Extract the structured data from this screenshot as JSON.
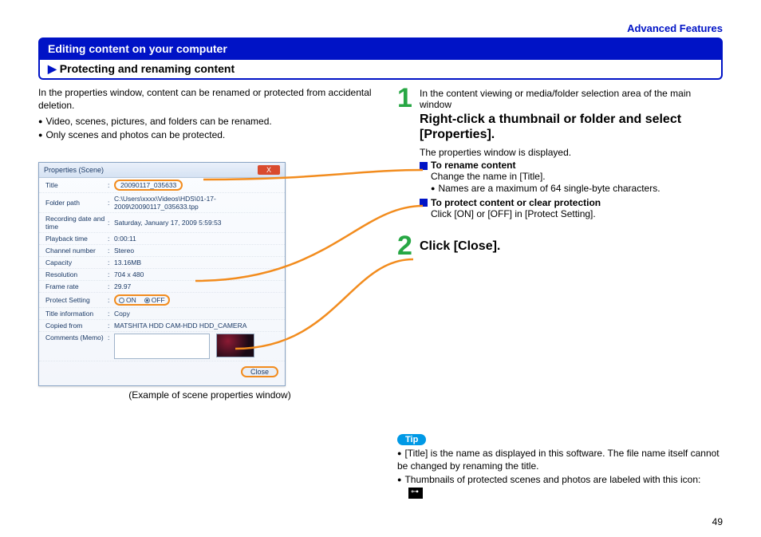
{
  "header": {
    "category": "Advanced Features"
  },
  "section": {
    "title": "Editing content on your computer",
    "subtitle": "Protecting and renaming content"
  },
  "left": {
    "intro": "In the properties window, content can be renamed or protected from accidental deletion.",
    "b1": "Video, scenes, pictures, and folders can be renamed.",
    "b2": "Only scenes and photos can be protected.",
    "caption": "(Example of scene properties window)"
  },
  "propwin": {
    "wtitle": "Properties (Scene)",
    "close_x": "X",
    "rows": {
      "title_l": "Title",
      "title_v": "20090117_035633",
      "folder_l": "Folder path",
      "folder_v": "C:\\Users\\xxxx\\Videos\\HDS\\01-17-2009\\20090117_035633.tpp",
      "rec_l": "Recording date and time",
      "rec_v": "Saturday, January 17, 2009 5:59:53",
      "play_l": "Playback time",
      "play_v": "0:00:11",
      "chan_l": "Channel number",
      "chan_v": "Stereo",
      "cap_l": "Capacity",
      "cap_v": "13.16MB",
      "res_l": "Resolution",
      "res_v": "704 x 480",
      "fr_l": "Frame rate",
      "fr_v": "29.97",
      "prot_l": "Protect Setting",
      "prot_on": "ON",
      "prot_off": "OFF",
      "ti_l": "Title information",
      "ti_v": "Copy",
      "cf_l": "Copied from",
      "cf_v": "MATSHITA HDD CAM-HDD   HDD_CAMERA",
      "cm_l": "Comments (Memo)"
    },
    "close_btn": "Close"
  },
  "steps": {
    "s1_pre": "In the content viewing or media/folder selection area of the main window",
    "s1_title": "Right-click a thumbnail or folder and select [Properties].",
    "s1_after": "The properties window is displayed.",
    "rename_h": "To rename content",
    "rename_t": "Change the name in [Title].",
    "rename_b": "Names are a maximum of 64 single-byte characters.",
    "protect_h": "To protect content or clear protection",
    "protect_t": "Click [ON] or [OFF] in [Protect Setting].",
    "s2_title": "Click [Close]."
  },
  "tip": {
    "label": "Tip",
    "t1": "[Title] is the name as displayed in this software. The file name itself cannot be changed by renaming the title.",
    "t2": "Thumbnails of protected scenes and photos are labeled with this icon:"
  },
  "page": "49"
}
